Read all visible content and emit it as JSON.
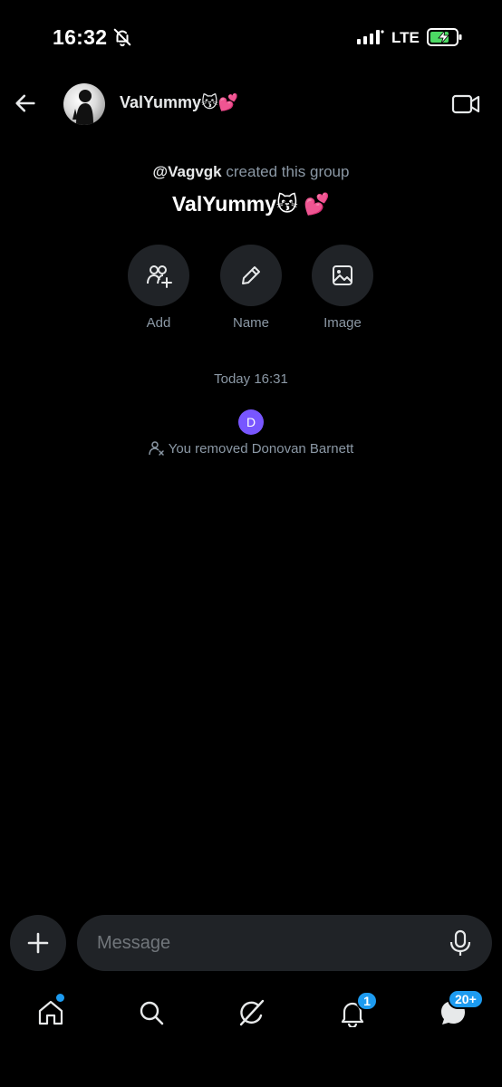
{
  "status_bar": {
    "time": "16:32",
    "network": "LTE"
  },
  "header": {
    "title": "ValYummy😽💕"
  },
  "group_info": {
    "creator_handle": "@Vagvgk",
    "creator_text": " created this group",
    "name": "ValYummy😽 💕"
  },
  "actions": [
    {
      "label": "Add",
      "icon": "add-people-icon"
    },
    {
      "label": "Name",
      "icon": "pencil-icon"
    },
    {
      "label": "Image",
      "icon": "image-icon"
    }
  ],
  "conversation": {
    "timestamp": "Today 16:31",
    "avatar_initial": "D",
    "event_text": "You removed Donovan Barnett"
  },
  "composer": {
    "placeholder": "Message"
  },
  "nav": {
    "notifications_badge": "1",
    "messages_badge": "20+"
  },
  "colors": {
    "background": "#000000",
    "surface": "#202327",
    "accent": "#1d9bf0",
    "avatar_purple": "#7856ff",
    "muted_text": "#8b98a5"
  }
}
